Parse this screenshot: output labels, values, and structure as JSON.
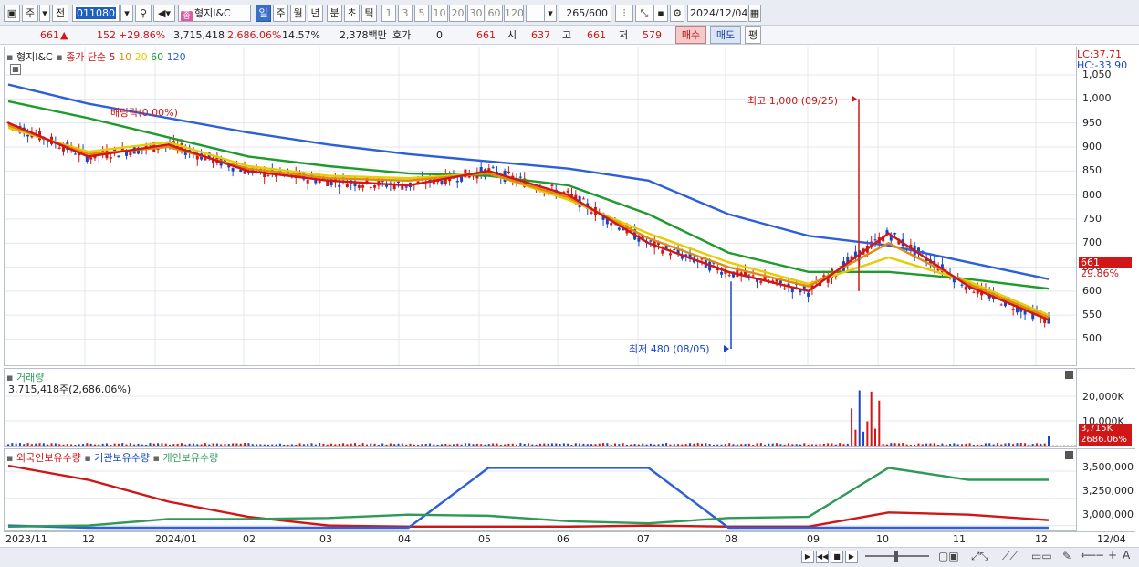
{
  "toolbar": {
    "period_unit": "주",
    "prev_label": "전",
    "code": "011080",
    "name_badge": "종",
    "name": "형지I&C",
    "periods": [
      "일",
      "주",
      "월",
      "년",
      "분",
      "초",
      "틱"
    ],
    "active_period": "일",
    "numbers": [
      "1",
      "3",
      "5",
      "10",
      "20",
      "30",
      "60",
      "120"
    ],
    "count": "265",
    "count_total": "/600",
    "date": "2024/12/04"
  },
  "info": {
    "price": "661",
    "change": "152",
    "change_pct": "+29.86%",
    "volume": "3,715,418",
    "volume_pct": "2,686.06%",
    "turnover": "14.57%",
    "amount": "2,378백만",
    "quote_label": "호가",
    "quote_val": "0",
    "quote_price": "661",
    "open_label": "시",
    "open": "637",
    "high_label": "고",
    "high": "661",
    "low_label": "저",
    "low": "579",
    "buy_label": "매수",
    "sell_label": "매도",
    "eval_label": "평"
  },
  "price_pane": {
    "legend_name": "형지I&C",
    "legend_type": "종가 단순",
    "ma_labels": [
      "5",
      "10",
      "20",
      "60",
      "120"
    ],
    "ma_colors": [
      "#d01616",
      "#e08a10",
      "#e6cc00",
      "#1f9a2c",
      "#2d5fd6"
    ],
    "lc": "LC:37.71",
    "hc": "HC:-33.90",
    "dividend_note": "배당락(0.00%)",
    "high_note": "최고 1,000 (09/25)",
    "low_note": "최저 480 (08/05)",
    "last_tag": "661",
    "last_pct": "29.86%",
    "y_ticks": [
      "1,050",
      "1,000",
      "950",
      "900",
      "850",
      "800",
      "750",
      "700",
      "650",
      "600",
      "550",
      "500"
    ]
  },
  "volume_pane": {
    "title": "거래량",
    "value": "3,715,418주(2,686.06%)",
    "y_ticks": [
      "20,000K",
      "10,000K"
    ],
    "last_tag": "3,715K",
    "last_pct": "2686.06%"
  },
  "holder_pane": {
    "legend": [
      "외국인보유수량",
      "기관보유수량",
      "개인보유수량"
    ],
    "colors": [
      "#d01616",
      "#2d5fd6",
      "#2f9a58"
    ],
    "y_ticks": [
      "3,500,000",
      "3,250,000",
      "3,000,000"
    ]
  },
  "x_axis": [
    "2023/11",
    "12",
    "2024/01",
    "02",
    "03",
    "04",
    "05",
    "06",
    "07",
    "08",
    "09",
    "10",
    "11",
    "12",
    "12/04"
  ],
  "chart_data": {
    "type": "line",
    "title": "",
    "x": [
      "2023/11",
      "12",
      "2024/01",
      "02",
      "03",
      "04",
      "05",
      "06",
      "07",
      "08",
      "09",
      "10",
      "11",
      "12"
    ],
    "price_ylim": [
      480,
      1050
    ],
    "series": [
      {
        "name": "5",
        "values": [
          950,
          880,
          905,
          850,
          830,
          820,
          850,
          800,
          700,
          640,
          600,
          720,
          610,
          540
        ]
      },
      {
        "name": "10",
        "values": [
          945,
          885,
          900,
          855,
          835,
          830,
          845,
          795,
          710,
          650,
          610,
          700,
          615,
          545
        ]
      },
      {
        "name": "20",
        "values": [
          940,
          890,
          910,
          860,
          840,
          835,
          845,
          790,
          720,
          660,
          615,
          670,
          620,
          550
        ]
      },
      {
        "name": "60",
        "values": [
          995,
          960,
          920,
          880,
          860,
          845,
          840,
          820,
          760,
          680,
          640,
          640,
          625,
          605
        ]
      },
      {
        "name": "120",
        "values": [
          1030,
          990,
          960,
          930,
          905,
          885,
          870,
          855,
          830,
          760,
          715,
          695,
          660,
          625
        ]
      }
    ],
    "price_high": {
      "value": 1000,
      "date": "09/25"
    },
    "price_low": {
      "value": 480,
      "date": "08/05"
    },
    "holders": [
      {
        "name": "외국인보유수량",
        "values": [
          3550000,
          3420000,
          3220000,
          3080000,
          3000000,
          2990000,
          2990000,
          2990000,
          3000000,
          2990000,
          2990000,
          3120000,
          3100000,
          3050000
        ]
      },
      {
        "name": "기관보유수량",
        "values": [
          3000000,
          2980000,
          2980000,
          2980000,
          2980000,
          2980000,
          3530000,
          3530000,
          3530000,
          2980000,
          2980000,
          2980000,
          2980000,
          2980000
        ]
      },
      {
        "name": "개인보유수량",
        "values": [
          2990000,
          3000000,
          3060000,
          3060000,
          3070000,
          3100000,
          3090000,
          3040000,
          3020000,
          3070000,
          3080000,
          3530000,
          3420000,
          3420000
        ]
      }
    ]
  }
}
